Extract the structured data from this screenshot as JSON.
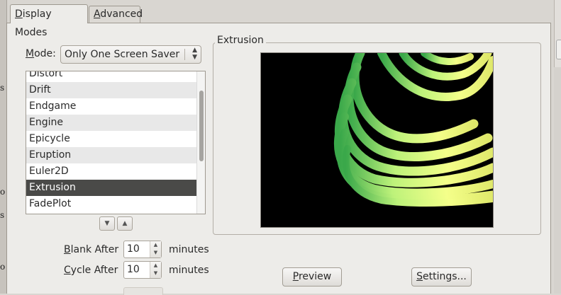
{
  "tabs": [
    {
      "label_pre": "",
      "label_u": "D",
      "label_post": "isplay Modes"
    },
    {
      "label_pre": "",
      "label_u": "A",
      "label_post": "dvanced"
    }
  ],
  "mode": {
    "label_u": "M",
    "label_post": "ode:",
    "value": "Only One Screen Saver"
  },
  "savers": [
    "Distort",
    "Drift",
    "Endgame",
    "Engine",
    "Epicycle",
    "Eruption",
    "Euler2D",
    "Extrusion",
    "FadePlot"
  ],
  "selected_saver": "Extrusion",
  "list_scroll": {
    "thumb_fraction_visible": 0.5
  },
  "blank_after": {
    "label_u": "B",
    "label_post": "lank After",
    "value": "10",
    "unit": "minutes"
  },
  "cycle_after": {
    "label_u": "C",
    "label_post": "ycle After",
    "value": "10",
    "unit": "minutes"
  },
  "preview_frame": {
    "title": "Extrusion"
  },
  "buttons": {
    "preview": {
      "u": "P",
      "post": "review"
    },
    "settings": {
      "u": "S",
      "post": "ettings..."
    }
  },
  "left_fragments": [
    "s",
    "o",
    "s",
    "o"
  ],
  "colors": {
    "selected_row": "#4a4a48",
    "odd_row": "#e8e8e8",
    "spiral_light": "#f4ff8a",
    "spiral_dark": "#3a9a3a"
  }
}
